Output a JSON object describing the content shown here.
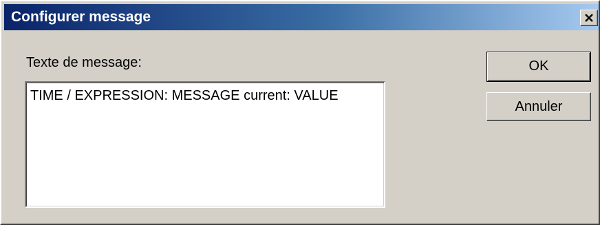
{
  "window": {
    "title": "Configurer message",
    "close_icon": "close-icon"
  },
  "form": {
    "prompt_label": "Texte de message:",
    "message_value": "TIME / EXPRESSION: MESSAGE current: VALUE"
  },
  "buttons": {
    "ok_label": "OK",
    "cancel_label": "Annuler"
  }
}
